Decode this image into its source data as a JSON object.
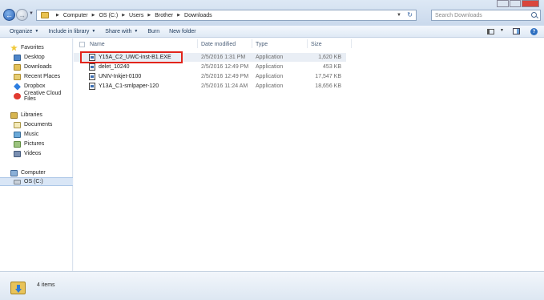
{
  "address_bar": {
    "breadcrumbs": [
      "Computer",
      "OS (C:)",
      "Users",
      "Brother",
      "Downloads"
    ],
    "search_placeholder": "Search Downloads"
  },
  "toolbar": {
    "organize": "Organize",
    "include_in_library": "Include in library",
    "share_with": "Share with",
    "burn": "Burn",
    "new_folder": "New folder"
  },
  "nav_pane": {
    "favorites_header": "Favorites",
    "favorites": [
      "Desktop",
      "Downloads",
      "Recent Places",
      "Dropbox",
      "Creative Cloud Files"
    ],
    "libraries_header": "Libraries",
    "libraries": [
      "Documents",
      "Music",
      "Pictures",
      "Videos"
    ],
    "computer_header": "Computer",
    "computer": [
      "OS (C:)"
    ]
  },
  "file_list": {
    "columns": [
      "Name",
      "Date modified",
      "Type",
      "Size"
    ],
    "rows": [
      {
        "name": "Y15A_C2_UWC-inst-B1.EXE",
        "date": "2/5/2016 1:31 PM",
        "type": "Application",
        "size": "1,620 KB"
      },
      {
        "name": "delet_10240",
        "date": "2/5/2016 12:49 PM",
        "type": "Application",
        "size": "453 KB"
      },
      {
        "name": "UNIV-Inkjet-0100",
        "date": "2/5/2016 12:49 PM",
        "type": "Application",
        "size": "17,547 KB"
      },
      {
        "name": "Y13A_C1-smlpaper-120",
        "date": "2/5/2016 11:24 AM",
        "type": "Application",
        "size": "18,656 KB"
      }
    ]
  },
  "details_pane": {
    "item_count": "4 items"
  },
  "colors": {
    "highlight_box": "#e2241b",
    "selection": "#d9e6f6"
  }
}
